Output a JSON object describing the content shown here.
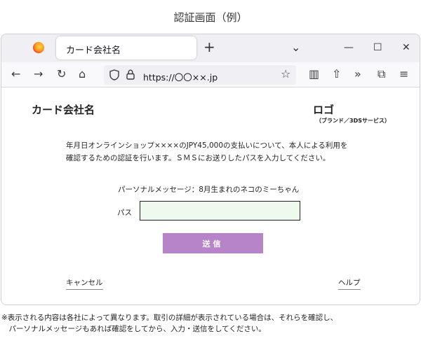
{
  "caption": {
    "title": "認証画面（例）"
  },
  "browser": {
    "tab": {
      "title": "カード会社名",
      "new_tab_symbol": "+"
    },
    "controls": {
      "list_all_tabs": "⌄",
      "minimize": "—",
      "maximize": "☐",
      "close": "✕"
    },
    "toolbar": {
      "back": "←",
      "forward": "→",
      "reload": "↻",
      "home": "⌂",
      "url": "https://〇〇××.jp",
      "bookmark": "☆",
      "sidebar": "▥",
      "save_to_pocket": "⇧",
      "more_tools": "»",
      "extensions": "⧉",
      "menu": "≡"
    },
    "icons": [
      "firefox-logo-icon",
      "shield-icon",
      "lock-icon",
      "bookmark-star-icon",
      "sidebar-icon",
      "pocket-icon",
      "extensions-icon",
      "menu-icon"
    ]
  },
  "page": {
    "company_name": "カード会社名",
    "logo": {
      "main": "ロゴ",
      "sub": "（ブランド／3DSサービス）"
    },
    "description_line1": "年月日オンラインショップ××××のJPY45,000の支払いについて、本人による利用を",
    "description_line2": "確認するための認証を行います。ＳＭＳにお送りしたパスを入力してください。",
    "personal_message": "パーソナルメッセージ：8月生まれのネコのミーちゃん",
    "pass_label": "パス",
    "pass_value": "",
    "submit_label": "送信",
    "cancel_label": "キャンセル",
    "help_label": "ヘルプ",
    "input_bg_color": "#effaef",
    "button_color": "#b784c9"
  },
  "footnote": {
    "line1": "※表示される内容は各社によって異なります。取引の詳細が表示されている場合は、それらを確認し、",
    "line2": "　パーソナルメッセージもあれば確認をしてから、入力・送信をしてください。"
  }
}
